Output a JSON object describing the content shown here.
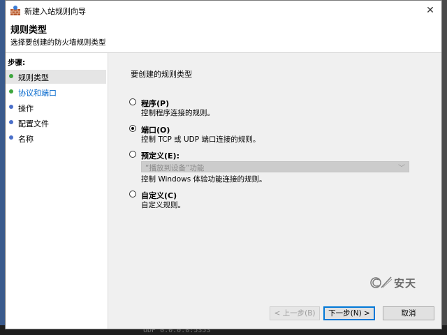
{
  "window": {
    "title": "新建入站规则向导",
    "close_glyph": "✕"
  },
  "header": {
    "title": "规则类型",
    "subtitle": "选择要创建的防火墙规则类型"
  },
  "sidebar": {
    "heading": "步骤:",
    "items": [
      {
        "label": "规则类型",
        "active": true,
        "color": "#3ea63e"
      },
      {
        "label": "协议和端口",
        "active": false,
        "color": "#3ea63e",
        "link_color": "#0066cc"
      },
      {
        "label": "操作",
        "active": false,
        "color": "#4a6fc9"
      },
      {
        "label": "配置文件",
        "active": false,
        "color": "#4a6fc9"
      },
      {
        "label": "名称",
        "active": false,
        "color": "#4a6fc9"
      }
    ]
  },
  "main": {
    "prompt": "要创建的规则类型",
    "options": [
      {
        "label": "程序(P)",
        "desc": "控制程序连接的规则。",
        "checked": false
      },
      {
        "label": "端口(O)",
        "desc": "控制 TCP 或 UDP 端口连接的规则。",
        "checked": true
      },
      {
        "label": "预定义(E):",
        "desc": "控制 Windows 体验功能连接的规则。",
        "checked": false
      },
      {
        "label": "自定义(C)",
        "desc": "自定义规则。",
        "checked": false
      }
    ],
    "predefined_select": {
      "value": "“播放到设备”功能"
    }
  },
  "watermark": {
    "text": "安天"
  },
  "buttons": {
    "back": "< 上一步(B)",
    "next": "下一步(N) >",
    "cancel": "取消"
  },
  "desktop": {
    "bottom_text": "UDP    0.0.0.0:5353"
  }
}
